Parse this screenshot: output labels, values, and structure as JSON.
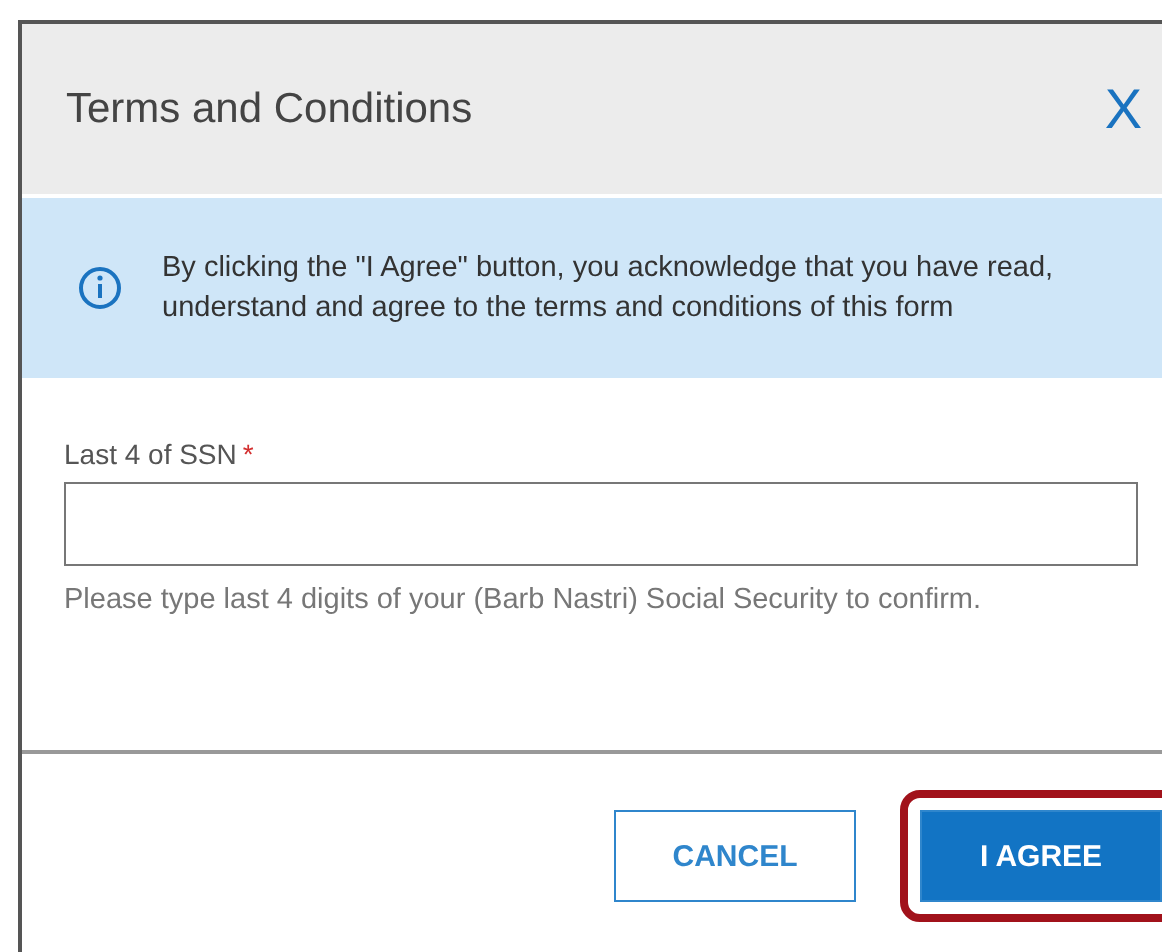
{
  "dialog": {
    "title": "Terms and Conditions",
    "close_icon": "X"
  },
  "notice": {
    "text": "By clicking the \"I Agree\" button, you acknowledge that you have read, understand and agree to the terms and conditions of this form"
  },
  "field": {
    "label": "Last 4 of SSN",
    "required_mark": "*",
    "help": "Please type last 4 digits of your (Barb Nastri) Social Security to confirm."
  },
  "buttons": [
    {
      "label": "CANCEL",
      "kind": "secondary",
      "highlighted": false
    },
    {
      "label": "I AGREE",
      "kind": "primary",
      "highlighted": true
    }
  ]
}
